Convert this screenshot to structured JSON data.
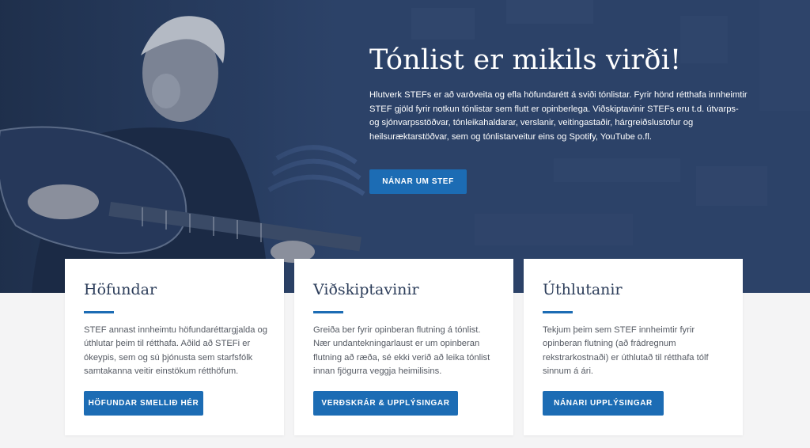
{
  "hero": {
    "title": "Tónlist er mikils virði!",
    "description": "Hlutverk STEFs er að varðveita og efla höfundarétt á sviði tónlistar. Fyrir hönd rétthafa innheimtir STEF gjöld fyrir notkun tónlistar sem flutt er opinberlega. Viðskiptavinir STEFs eru t.d. útvarps- og sjónvarpsstöðvar, tónleikahaldarar, verslanir, veitingastaðir, hárgreiðslustofur og heilsuræktarstöðvar, sem og tónlistarveitur eins og Spotify, YouTube o.fl.",
    "button_label": "NÁNAR UM STEF"
  },
  "cards": [
    {
      "title": "Höfundar",
      "text": "STEF annast innheimtu höfundaréttargjalda og úthlutar þeim til rétthafa. Aðild að STEFi er ókeypis, sem og sú þjónusta sem starfsfólk samtakanna veitir einstökum rétthöfum.",
      "button_label": "HÖFUNDAR SMELLIÐ HÉR"
    },
    {
      "title": "Viðskiptavinir",
      "text": "Greiða ber fyrir opinberan flutning á tónlist. Nær undantekningarlaust er um opinberan flutning að ræða, sé ekki verið að leika tónlist innan fjögurra veggja heimilisins.",
      "button_label": "VERÐSKRÁR & UPPLÝSINGAR"
    },
    {
      "title": "Úthlutanir",
      "text": "Tekjum þeim sem STEF innheimtir fyrir opinberan flutning (að frádregnum rekstrarkostnaði) er úthlutað til rétthafa tólf sinnum á ári.",
      "button_label": "NÁNARI UPPLÝSINGAR"
    }
  ],
  "colors": {
    "hero_background": "#2c4268",
    "accent": "#1c6cb4",
    "page_background": "#f4f4f5",
    "card_title": "#2c3d5a"
  }
}
